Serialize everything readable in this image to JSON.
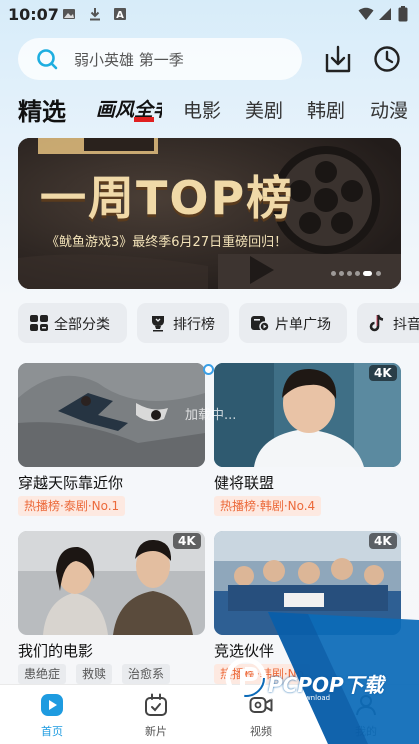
{
  "status_bar": {
    "time": "10:07",
    "icons": [
      "image-icon",
      "download-icon",
      "font-icon",
      "wifi-icon",
      "signal-icon",
      "battery-icon"
    ]
  },
  "search": {
    "placeholder": "弱小英雄 第一季"
  },
  "top_actions": [
    "download-icon",
    "history-clock-icon"
  ],
  "tabs": [
    {
      "label": "精选",
      "active": true
    },
    {
      "label": "画风全非",
      "is_logo": true
    },
    {
      "label": "电影"
    },
    {
      "label": "美剧"
    },
    {
      "label": "韩剧"
    },
    {
      "label": "动漫"
    }
  ],
  "banner": {
    "title": "一周TOP榜",
    "subtitle": "《鱿鱼游戏3》最终季6月27日重磅回归！",
    "dot_count": 6,
    "active_dot": 4
  },
  "chips": [
    {
      "label": "全部分类",
      "icon": "category-icon"
    },
    {
      "label": "排行榜",
      "icon": "trophy-icon"
    },
    {
      "label": "片单广场",
      "icon": "playlist-icon"
    },
    {
      "label": "抖音",
      "icon": "tiktok-icon"
    }
  ],
  "cards": [
    {
      "title": "穿越天际靠近你",
      "rank": "热播榜·泰剧·No.1",
      "tags": [],
      "badge": ""
    },
    {
      "title": "健将联盟",
      "rank": "热播榜·韩剧·No.4",
      "tags": [],
      "badge": "4K"
    },
    {
      "title": "我们的电影",
      "rank": "",
      "tags": [
        "患绝症",
        "救赎",
        "治愈系"
      ],
      "badge": "4K"
    },
    {
      "title": "竞选伙伴",
      "rank": "热播榜·韩剧·No",
      "tags": [],
      "badge": "4K"
    }
  ],
  "loading_text": "加载中...",
  "bottom_nav": [
    {
      "label": "首页",
      "icon": "home-play-icon",
      "active": true
    },
    {
      "label": "新片",
      "icon": "calendar-tv-icon"
    },
    {
      "label": "视频",
      "icon": "video-camera-icon"
    },
    {
      "label": "我的",
      "icon": "profile-icon"
    }
  ],
  "watermark": {
    "text": "PCPOP下载",
    "sub": "PCPOP Download"
  },
  "colors": {
    "accent": "#1e9be0",
    "rank_text": "#ec6a3b",
    "rank_bg": "#fde9e1",
    "banner_gold": "#f0d9a8"
  }
}
